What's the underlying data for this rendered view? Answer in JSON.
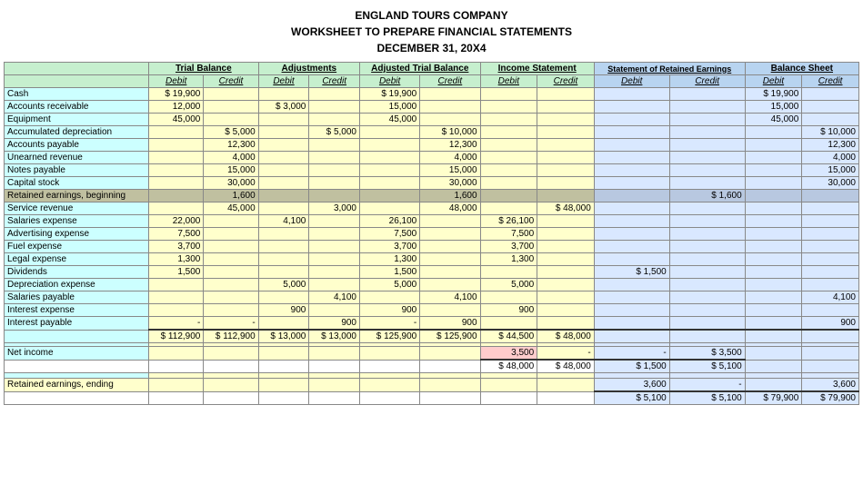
{
  "title": {
    "line1": "ENGLAND TOURS COMPANY",
    "line2": "WORKSHEET TO PREPARE FINANCIAL STATEMENTS",
    "line3": "DECEMBER 31, 20X4"
  },
  "headers": {
    "trial_balance": "Trial Balance",
    "adjustments": "Adjustments",
    "adjusted_trial_balance": "Adjusted Trial Balance",
    "income_statement": "Income Statement",
    "statement_retained": "Statement of Retained Earnings",
    "balance_sheet": "Balance Sheet"
  },
  "col_labels": {
    "debit": "Debit",
    "credit": "Credit"
  },
  "rows": [
    {
      "label": "Cash",
      "tb_d": "$ 19,900",
      "tb_c": "",
      "adj_d": "",
      "adj_c": "",
      "atb_d": "$ 19,900",
      "atb_c": "",
      "is_d": "",
      "is_c": "",
      "re_d": "",
      "re_c": "",
      "bs_d": "$ 19,900",
      "bs_c": ""
    },
    {
      "label": "Accounts receivable",
      "tb_d": "12,000",
      "tb_c": "",
      "adj_d": "$ 3,000",
      "adj_c": "",
      "atb_d": "15,000",
      "atb_c": "",
      "is_d": "",
      "is_c": "",
      "re_d": "",
      "re_c": "",
      "bs_d": "15,000",
      "bs_c": ""
    },
    {
      "label": "Equipment",
      "tb_d": "45,000",
      "tb_c": "",
      "adj_d": "",
      "adj_c": "",
      "atb_d": "45,000",
      "atb_c": "",
      "is_d": "",
      "is_c": "",
      "re_d": "",
      "re_c": "",
      "bs_d": "45,000",
      "bs_c": ""
    },
    {
      "label": "Accumulated depreciation",
      "tb_d": "",
      "tb_c": "$ 5,000",
      "adj_d": "",
      "adj_c": "$ 5,000",
      "atb_d": "",
      "atb_c": "$ 10,000",
      "is_d": "",
      "is_c": "",
      "re_d": "",
      "re_c": "",
      "bs_d": "",
      "bs_c": "$ 10,000"
    },
    {
      "label": "Accounts payable",
      "tb_d": "",
      "tb_c": "12,300",
      "adj_d": "",
      "adj_c": "",
      "atb_d": "",
      "atb_c": "12,300",
      "is_d": "",
      "is_c": "",
      "re_d": "",
      "re_c": "",
      "bs_d": "",
      "bs_c": "12,300"
    },
    {
      "label": "Unearned revenue",
      "tb_d": "",
      "tb_c": "4,000",
      "adj_d": "",
      "adj_c": "",
      "atb_d": "",
      "atb_c": "4,000",
      "is_d": "",
      "is_c": "",
      "re_d": "",
      "re_c": "",
      "bs_d": "",
      "bs_c": "4,000"
    },
    {
      "label": "Notes payable",
      "tb_d": "",
      "tb_c": "15,000",
      "adj_d": "",
      "adj_c": "",
      "atb_d": "",
      "atb_c": "15,000",
      "is_d": "",
      "is_c": "",
      "re_d": "",
      "re_c": "",
      "bs_d": "",
      "bs_c": "15,000"
    },
    {
      "label": "Capital stock",
      "tb_d": "",
      "tb_c": "30,000",
      "adj_d": "",
      "adj_c": "",
      "atb_d": "",
      "atb_c": "30,000",
      "is_d": "",
      "is_c": "",
      "re_d": "",
      "re_c": "",
      "bs_d": "",
      "bs_c": "30,000"
    },
    {
      "label": "Retained earnings, beginning",
      "tb_d": "",
      "tb_c": "1,600",
      "adj_d": "",
      "adj_c": "",
      "atb_d": "",
      "atb_c": "1,600",
      "is_d": "",
      "is_c": "",
      "re_d": "",
      "re_c": "$ 1,600",
      "bs_d": "",
      "bs_c": "",
      "highlight": true
    },
    {
      "label": "Service revenue",
      "tb_d": "",
      "tb_c": "45,000",
      "adj_d": "",
      "adj_c": "3,000",
      "atb_d": "",
      "atb_c": "48,000",
      "is_d": "",
      "is_c": "$ 48,000",
      "re_d": "",
      "re_c": "",
      "bs_d": "",
      "bs_c": ""
    },
    {
      "label": "Salaries expense",
      "tb_d": "22,000",
      "tb_c": "",
      "adj_d": "4,100",
      "adj_c": "",
      "atb_d": "26,100",
      "atb_c": "",
      "is_d": "$ 26,100",
      "is_c": "",
      "re_d": "",
      "re_c": "",
      "bs_d": "",
      "bs_c": ""
    },
    {
      "label": "Advertising expense",
      "tb_d": "7,500",
      "tb_c": "",
      "adj_d": "",
      "adj_c": "",
      "atb_d": "7,500",
      "atb_c": "",
      "is_d": "7,500",
      "is_c": "",
      "re_d": "",
      "re_c": "",
      "bs_d": "",
      "bs_c": ""
    },
    {
      "label": "Fuel expense",
      "tb_d": "3,700",
      "tb_c": "",
      "adj_d": "",
      "adj_c": "",
      "atb_d": "3,700",
      "atb_c": "",
      "is_d": "3,700",
      "is_c": "",
      "re_d": "",
      "re_c": "",
      "bs_d": "",
      "bs_c": ""
    },
    {
      "label": "Legal expense",
      "tb_d": "1,300",
      "tb_c": "",
      "adj_d": "",
      "adj_c": "",
      "atb_d": "1,300",
      "atb_c": "",
      "is_d": "1,300",
      "is_c": "",
      "re_d": "",
      "re_c": "",
      "bs_d": "",
      "bs_c": ""
    },
    {
      "label": "Dividends",
      "tb_d": "1,500",
      "tb_c": "",
      "adj_d": "",
      "adj_c": "",
      "atb_d": "1,500",
      "atb_c": "",
      "is_d": "",
      "is_c": "",
      "re_d": "$ 1,500",
      "re_c": "",
      "bs_d": "",
      "bs_c": ""
    },
    {
      "label": "Depreciation expense",
      "tb_d": "",
      "tb_c": "",
      "adj_d": "5,000",
      "adj_c": "",
      "atb_d": "5,000",
      "atb_c": "",
      "is_d": "5,000",
      "is_c": "",
      "re_d": "",
      "re_c": "",
      "bs_d": "",
      "bs_c": ""
    },
    {
      "label": "Salaries payable",
      "tb_d": "",
      "tb_c": "",
      "adj_d": "",
      "adj_c": "4,100",
      "atb_d": "",
      "atb_c": "4,100",
      "is_d": "",
      "is_c": "",
      "re_d": "",
      "re_c": "",
      "bs_d": "",
      "bs_c": "4,100"
    },
    {
      "label": "Interest expense",
      "tb_d": "",
      "tb_c": "",
      "adj_d": "900",
      "adj_c": "",
      "atb_d": "900",
      "atb_c": "",
      "is_d": "900",
      "is_c": "",
      "re_d": "",
      "re_c": "",
      "bs_d": "",
      "bs_c": ""
    },
    {
      "label": "Interest payable",
      "tb_d": "-",
      "tb_c": "-",
      "adj_d": "",
      "adj_c": "900",
      "atb_d": "-",
      "atb_c": "900",
      "is_d": "",
      "is_c": "",
      "re_d": "",
      "re_c": "",
      "bs_d": "",
      "bs_c": "900"
    }
  ],
  "totals": {
    "label": "",
    "tb_d": "$ 112,900",
    "tb_c": "$ 112,900",
    "adj_d": "$ 13,000",
    "adj_c": "$ 13,000",
    "atb_d": "$ 125,900",
    "atb_c": "$ 125,900",
    "is_d": "$ 44,500",
    "is_c": "$ 48,000",
    "re_d": "",
    "re_c": "",
    "bs_d": "",
    "bs_c": ""
  },
  "net_income": {
    "label": "Net income",
    "is_d_highlight": "3,500",
    "is_c": "-",
    "re_d": "-",
    "re_c": "$ 3,500"
  },
  "is_totals": {
    "is_d": "$ 48,000",
    "is_c": "$ 48,000",
    "re_d": "$ 1,500",
    "re_c": "$ 5,100",
    "bs_d": "",
    "bs_c": ""
  },
  "re_ending": {
    "label": "Retained earnings, ending",
    "re_d": "3,600",
    "re_c": "-",
    "bs_d": "",
    "bs_c": "3,600"
  },
  "final_totals": {
    "re_d": "$ 5,100",
    "re_c": "$ 5,100",
    "bs_d": "$ 79,900",
    "bs_c": "$ 79,900"
  }
}
